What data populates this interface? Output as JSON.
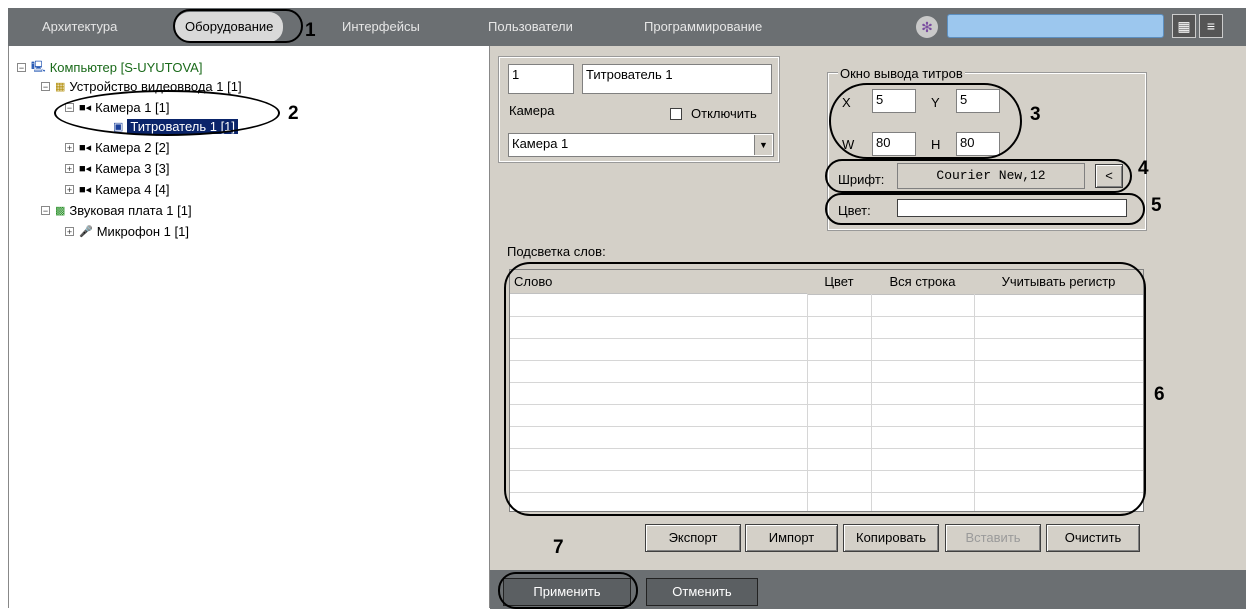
{
  "topbar": {
    "tabs": [
      {
        "label": "Архитектура"
      },
      {
        "label": "Оборудование"
      },
      {
        "label": "Интерфейсы"
      },
      {
        "label": "Пользователи"
      },
      {
        "label": "Программирование"
      }
    ],
    "icons": [
      "gear-icon",
      "grid-view-icon",
      "list-view-icon"
    ]
  },
  "tree": {
    "computer": "Компьютер [S-UYUTOVA]",
    "video_device": "Устройство видеоввода 1 [1]",
    "camera1": "Камера 1 [1]",
    "titler": "Титрователь 1 [1]",
    "camera2": "Камера 2 [2]",
    "camera3": "Камера 3 [3]",
    "camera4": "Камера 4 [4]",
    "sound_card": "Звуковая плата 1 [1]",
    "microphone": "Микрофон 1 [1]"
  },
  "form": {
    "id_value": "1",
    "name_value": "Титрователь 1",
    "camera_label": "Камера",
    "disable_label": "Отключить",
    "camera_select": "Камера 1",
    "output_group": "Окно вывода титров",
    "x_label": "X",
    "x_value": "5",
    "y_label": "Y",
    "y_value": "5",
    "w_label": "W",
    "w_value": "80",
    "h_label": "H",
    "h_value": "80",
    "font_label": "Шрифт:",
    "font_value": "Courier New,12",
    "font_button": "<",
    "color_label": "Цвет:",
    "highlight_label": "Подсветка слов:"
  },
  "table": {
    "headers": [
      "Слово",
      "Цвет",
      "Вся строка",
      "Учитывать регистр"
    ]
  },
  "buttons": {
    "export": "Экспорт",
    "import": "Импорт",
    "copy": "Копировать",
    "paste": "Вставить",
    "clear": "Очистить",
    "apply": "Применить",
    "cancel": "Отменить"
  },
  "callouts": [
    "1",
    "2",
    "3",
    "4",
    "5",
    "6",
    "7"
  ],
  "colors": {
    "topbar_bg": "#6b6f72",
    "panel_bg": "#d4d0c8",
    "selection": "#0a246a"
  }
}
